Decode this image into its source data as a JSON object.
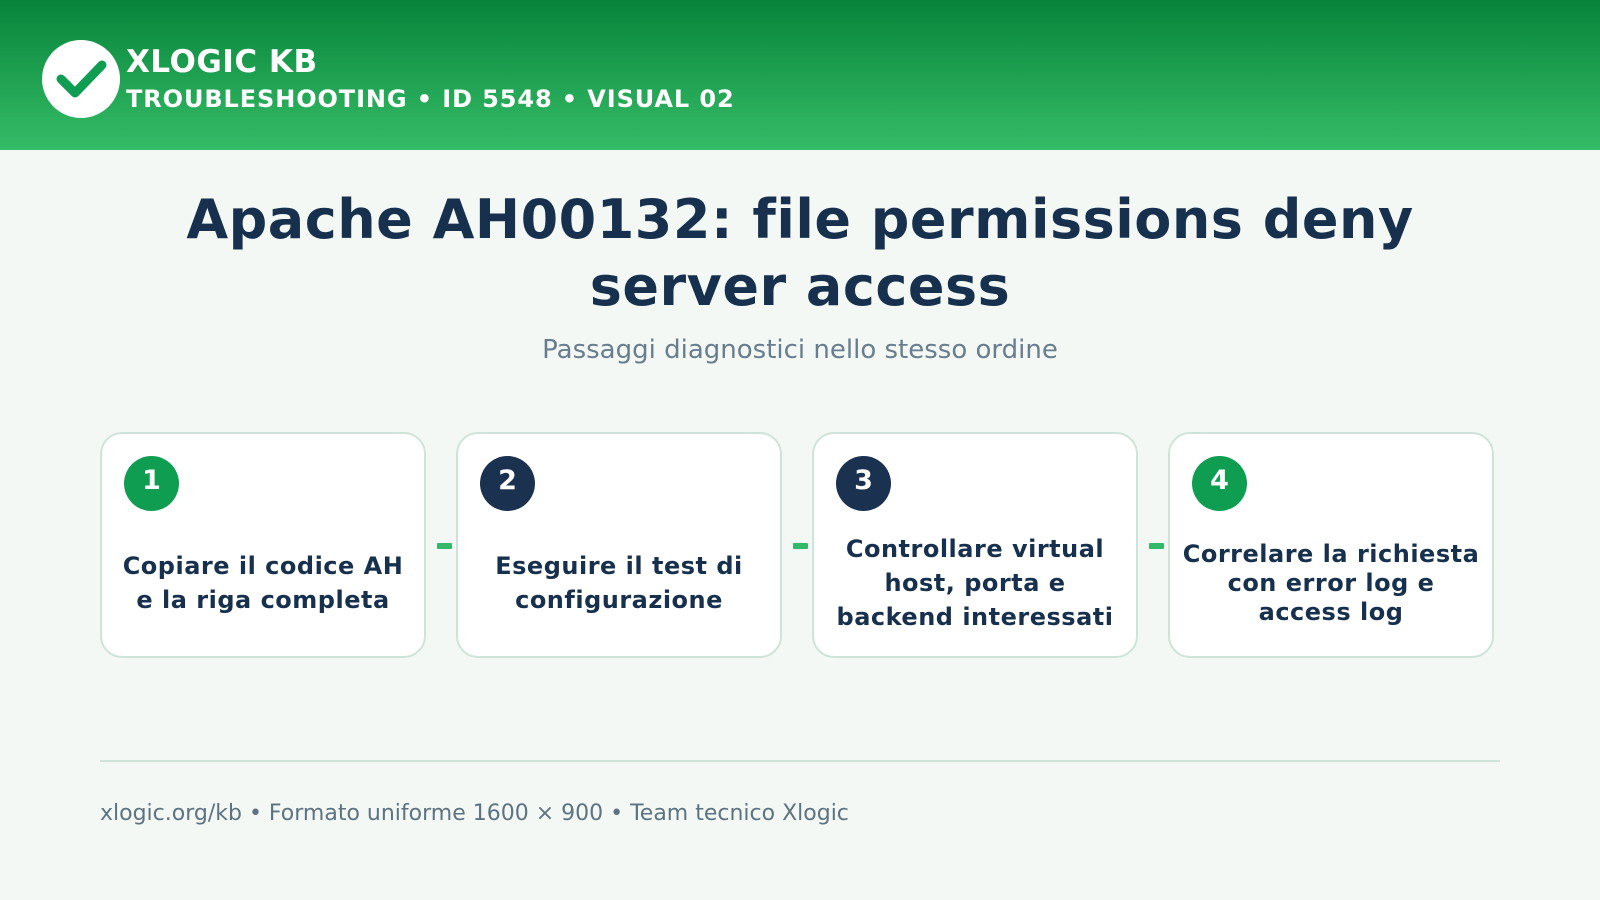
{
  "header": {
    "logo_icon": "checkmark-icon",
    "brand": "XLOGIC KB",
    "tagline": "TROUBLESHOOTING • ID 5548 • VISUAL 02",
    "colors": {
      "gradient_top": "#07843a",
      "gradient_bottom": "#35bc67"
    }
  },
  "main": {
    "title": "Apache AH00132: file permissions deny server access",
    "subtitle": "Passaggi diagnostici nello stesso ordine"
  },
  "steps": [
    {
      "number": "1",
      "text": "Copiare il codice AH e la riga completa",
      "badge_color": "#0f9d52"
    },
    {
      "number": "2",
      "text": "Eseguire il test di configurazione",
      "badge_color": "#1b3150"
    },
    {
      "number": "3",
      "text": "Controllare virtual host, porta e backend interessati",
      "badge_color": "#1b3150"
    },
    {
      "number": "4",
      "text": "Correlare la richiesta con error log e access log",
      "badge_color": "#0f9d52"
    }
  ],
  "footer": {
    "text": "xlogic.org/kb • Formato uniforme 1600 × 900 • Team tecnico Xlogic"
  }
}
